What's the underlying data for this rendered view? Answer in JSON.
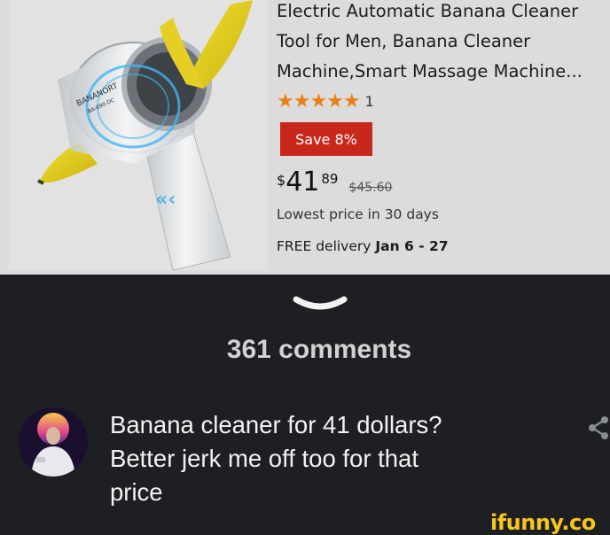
{
  "product": {
    "title_lines": [
      "Electric Automatic Banana Cleaner",
      "Tool for Men, Banana Cleaner",
      "Machine,Smart Massage Machine..."
    ],
    "stars": "★★★★★",
    "rating_value": 5,
    "rating_count": "1",
    "save_label": "Save 8%",
    "price_currency": "$",
    "price_whole": "41",
    "price_fraction": "89",
    "price_old": "$45.60",
    "lowest_price": "Lowest price in 30 days",
    "delivery_prefix": "FREE delivery ",
    "delivery_dates": "Jan 6 - 27",
    "image_brand": "BANANORT",
    "image_model": "BA-090-DC"
  },
  "comments": {
    "count_label": "361 comments"
  },
  "comment": {
    "lines": [
      "Banana cleaner for 41 dollars?",
      "Better jerk me off too for that",
      "price"
    ]
  },
  "watermark": "ifunny.co",
  "colors": {
    "page_bg": "#1d1f23",
    "product_bg": "#dcdcdc",
    "save_badge": "#c8271b",
    "stars": "#e8801a",
    "watermark": "#f7c51c",
    "comment_text": "#f2f2f2"
  },
  "icons": {
    "chevron": "chevron-down-icon",
    "share": "share-icon",
    "avatar": "avatar"
  }
}
